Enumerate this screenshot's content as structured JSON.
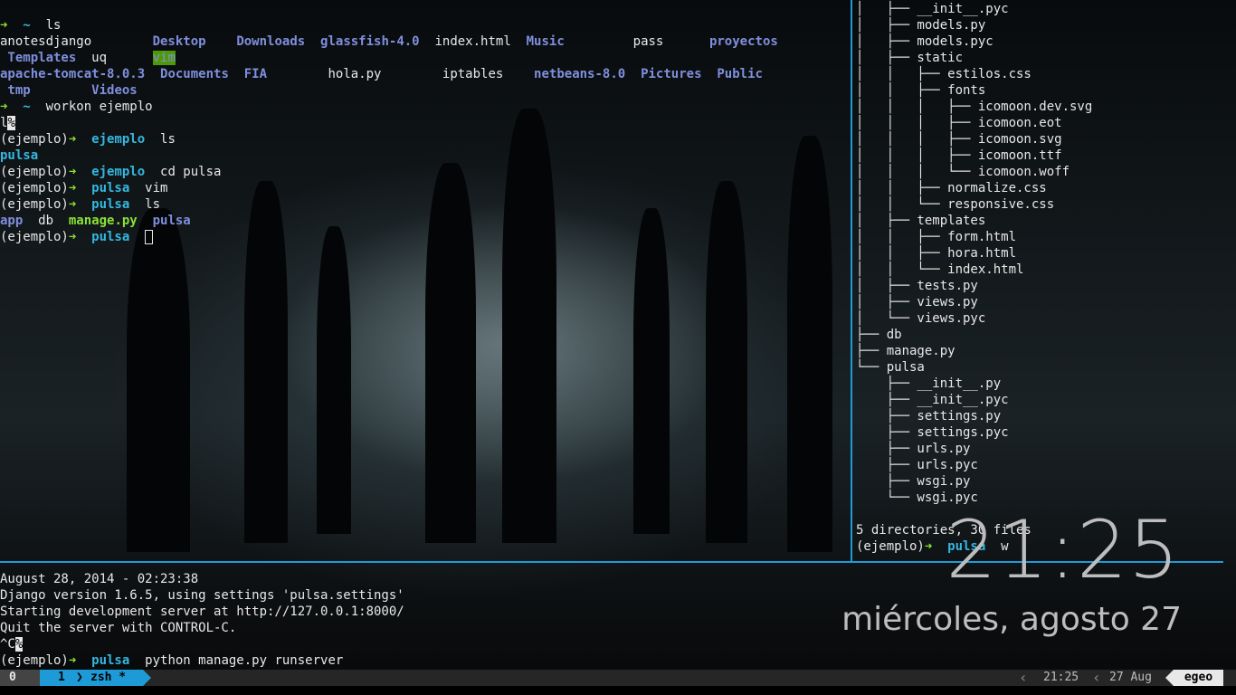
{
  "left_pane": {
    "lines": [
      [
        {
          "t": "➜ ",
          "c": "arrow"
        },
        {
          "t": " ~  ",
          "c": "cwd"
        },
        {
          "t": "ls",
          "c": ""
        }
      ],
      [
        {
          "t": "anotesdjango        ",
          "c": ""
        },
        {
          "t": "Desktop",
          "c": "dir"
        },
        {
          "t": "    ",
          "c": ""
        },
        {
          "t": "Downloads",
          "c": "dir"
        },
        {
          "t": "  ",
          "c": ""
        },
        {
          "t": "glassfish-4.0",
          "c": "dir"
        },
        {
          "t": "  index.html  ",
          "c": ""
        },
        {
          "t": "Music",
          "c": "dir"
        },
        {
          "t": "         pass      ",
          "c": ""
        },
        {
          "t": "proyectos",
          "c": "dir"
        }
      ],
      [
        {
          "t": " Templates",
          "c": "dir"
        },
        {
          "t": "  uq      ",
          "c": ""
        },
        {
          "t": "vim",
          "c": "hl"
        }
      ],
      [
        {
          "t": "apache-tomcat-8.0.3",
          "c": "dir"
        },
        {
          "t": "  ",
          "c": ""
        },
        {
          "t": "Documents",
          "c": "dir"
        },
        {
          "t": "  ",
          "c": ""
        },
        {
          "t": "FIA",
          "c": "dir"
        },
        {
          "t": "        hola.py        iptables    ",
          "c": ""
        },
        {
          "t": "netbeans-8.0",
          "c": "dir"
        },
        {
          "t": "  ",
          "c": ""
        },
        {
          "t": "Pictures",
          "c": "dir"
        },
        {
          "t": "  ",
          "c": ""
        },
        {
          "t": "Public",
          "c": "dir"
        }
      ],
      [
        {
          "t": " tmp",
          "c": "dir"
        },
        {
          "t": "        ",
          "c": ""
        },
        {
          "t": "Videos",
          "c": "dir"
        }
      ],
      [
        {
          "t": "➜ ",
          "c": "arrow"
        },
        {
          "t": " ~  ",
          "c": "cwd"
        },
        {
          "t": "workon ejemplo",
          "c": ""
        }
      ],
      [
        {
          "t": "l",
          "c": ""
        },
        {
          "t": "%",
          "c": "inv"
        }
      ],
      [
        {
          "t": "(ejemplo)",
          "c": ""
        },
        {
          "t": "➜ ",
          "c": "arrow"
        },
        {
          "t": " ejemplo  ",
          "c": "cwd"
        },
        {
          "t": "ls",
          "c": ""
        }
      ],
      [
        {
          "t": "pulsa",
          "c": "cwd"
        }
      ],
      [
        {
          "t": "(ejemplo)",
          "c": ""
        },
        {
          "t": "➜ ",
          "c": "arrow"
        },
        {
          "t": " ejemplo  ",
          "c": "cwd"
        },
        {
          "t": "cd pulsa",
          "c": ""
        }
      ],
      [
        {
          "t": "(ejemplo)",
          "c": ""
        },
        {
          "t": "➜ ",
          "c": "arrow"
        },
        {
          "t": " pulsa  ",
          "c": "cwd"
        },
        {
          "t": "vim",
          "c": ""
        }
      ],
      [
        {
          "t": "(ejemplo)",
          "c": ""
        },
        {
          "t": "➜ ",
          "c": "arrow"
        },
        {
          "t": " pulsa  ",
          "c": "cwd"
        },
        {
          "t": "ls",
          "c": ""
        }
      ],
      [
        {
          "t": "app",
          "c": "dir"
        },
        {
          "t": "  db  ",
          "c": ""
        },
        {
          "t": "manage.py",
          "c": "exec"
        },
        {
          "t": "  ",
          "c": ""
        },
        {
          "t": "pulsa",
          "c": "dir"
        }
      ],
      [
        {
          "t": "(ejemplo)",
          "c": ""
        },
        {
          "t": "➜ ",
          "c": "arrow"
        },
        {
          "t": " pulsa  ",
          "c": "cwd"
        },
        {
          "t": "",
          "c": "cursor"
        }
      ]
    ]
  },
  "tree_pane": {
    "lines": [
      [
        {
          "t": "│   ├── __init__.pyc",
          "c": ""
        }
      ],
      [
        {
          "t": "│   ├── models.py",
          "c": ""
        }
      ],
      [
        {
          "t": "│   ├── models.pyc",
          "c": ""
        }
      ],
      [
        {
          "t": "│   ├── static",
          "c": ""
        }
      ],
      [
        {
          "t": "│   │   ├── estilos.css",
          "c": ""
        }
      ],
      [
        {
          "t": "│   │   ├── fonts",
          "c": ""
        }
      ],
      [
        {
          "t": "│   │   │   ├── icomoon.dev.svg",
          "c": ""
        }
      ],
      [
        {
          "t": "│   │   │   ├── icomoon.eot",
          "c": ""
        }
      ],
      [
        {
          "t": "│   │   │   ├── icomoon.svg",
          "c": ""
        }
      ],
      [
        {
          "t": "│   │   │   ├── icomoon.ttf",
          "c": ""
        }
      ],
      [
        {
          "t": "│   │   │   └── icomoon.woff",
          "c": ""
        }
      ],
      [
        {
          "t": "│   │   ├── normalize.css",
          "c": ""
        }
      ],
      [
        {
          "t": "│   │   └── responsive.css",
          "c": ""
        }
      ],
      [
        {
          "t": "│   ├── templates",
          "c": ""
        }
      ],
      [
        {
          "t": "│   │   ├── form.html",
          "c": ""
        }
      ],
      [
        {
          "t": "│   │   ├── hora.html",
          "c": ""
        }
      ],
      [
        {
          "t": "│   │   └── index.html",
          "c": ""
        }
      ],
      [
        {
          "t": "│   ├── tests.py",
          "c": ""
        }
      ],
      [
        {
          "t": "│   ├── views.py",
          "c": ""
        }
      ],
      [
        {
          "t": "│   └── views.pyc",
          "c": ""
        }
      ],
      [
        {
          "t": "├── db",
          "c": ""
        }
      ],
      [
        {
          "t": "├── manage.py",
          "c": ""
        }
      ],
      [
        {
          "t": "└── pulsa",
          "c": ""
        }
      ],
      [
        {
          "t": "    ├── __init__.py",
          "c": ""
        }
      ],
      [
        {
          "t": "    ├── __init__.pyc",
          "c": ""
        }
      ],
      [
        {
          "t": "    ├── settings.py",
          "c": ""
        }
      ],
      [
        {
          "t": "    ├── settings.pyc",
          "c": ""
        }
      ],
      [
        {
          "t": "    ├── urls.py",
          "c": ""
        }
      ],
      [
        {
          "t": "    ├── urls.pyc",
          "c": ""
        }
      ],
      [
        {
          "t": "    ├── wsgi.py",
          "c": ""
        }
      ],
      [
        {
          "t": "    └── wsgi.pyc",
          "c": ""
        }
      ],
      [
        {
          "t": "",
          "c": ""
        }
      ],
      [
        {
          "t": "5 directories, 30 files",
          "c": ""
        }
      ],
      [
        {
          "t": "(ejemplo)",
          "c": ""
        },
        {
          "t": "➜ ",
          "c": "arrow"
        },
        {
          "t": " pulsa  ",
          "c": "cwd"
        },
        {
          "t": "w",
          "c": ""
        }
      ]
    ]
  },
  "bottom_pane": {
    "lines": [
      [
        {
          "t": "August 28, 2014 - 02:23:38",
          "c": ""
        }
      ],
      [
        {
          "t": "Django version 1.6.5, using settings 'pulsa.settings'",
          "c": ""
        }
      ],
      [
        {
          "t": "Starting development server at http://127.0.0.1:8000/",
          "c": ""
        }
      ],
      [
        {
          "t": "Quit the server with CONTROL-C.",
          "c": ""
        }
      ],
      [
        {
          "t": "^C",
          "c": ""
        },
        {
          "t": "%",
          "c": "inv"
        }
      ],
      [
        {
          "t": "(ejemplo)",
          "c": ""
        },
        {
          "t": "➜ ",
          "c": "arrow"
        },
        {
          "t": " pulsa  ",
          "c": "cwd"
        },
        {
          "t": "python manage.py runserver",
          "c": ""
        }
      ]
    ]
  },
  "desktop_clock": {
    "time": "21:25",
    "date": "miércoles, agosto 27"
  },
  "tmux_status": {
    "session": "0",
    "window_index": "1",
    "window_name": "zsh *",
    "time": "21:25",
    "date": "27 Aug",
    "host": "egeo",
    "colors": {
      "session_bg": "#444444",
      "window_bg": "#1e9bd7",
      "bar_bg": "#262626",
      "host_bg": "#e8e8e8"
    }
  }
}
